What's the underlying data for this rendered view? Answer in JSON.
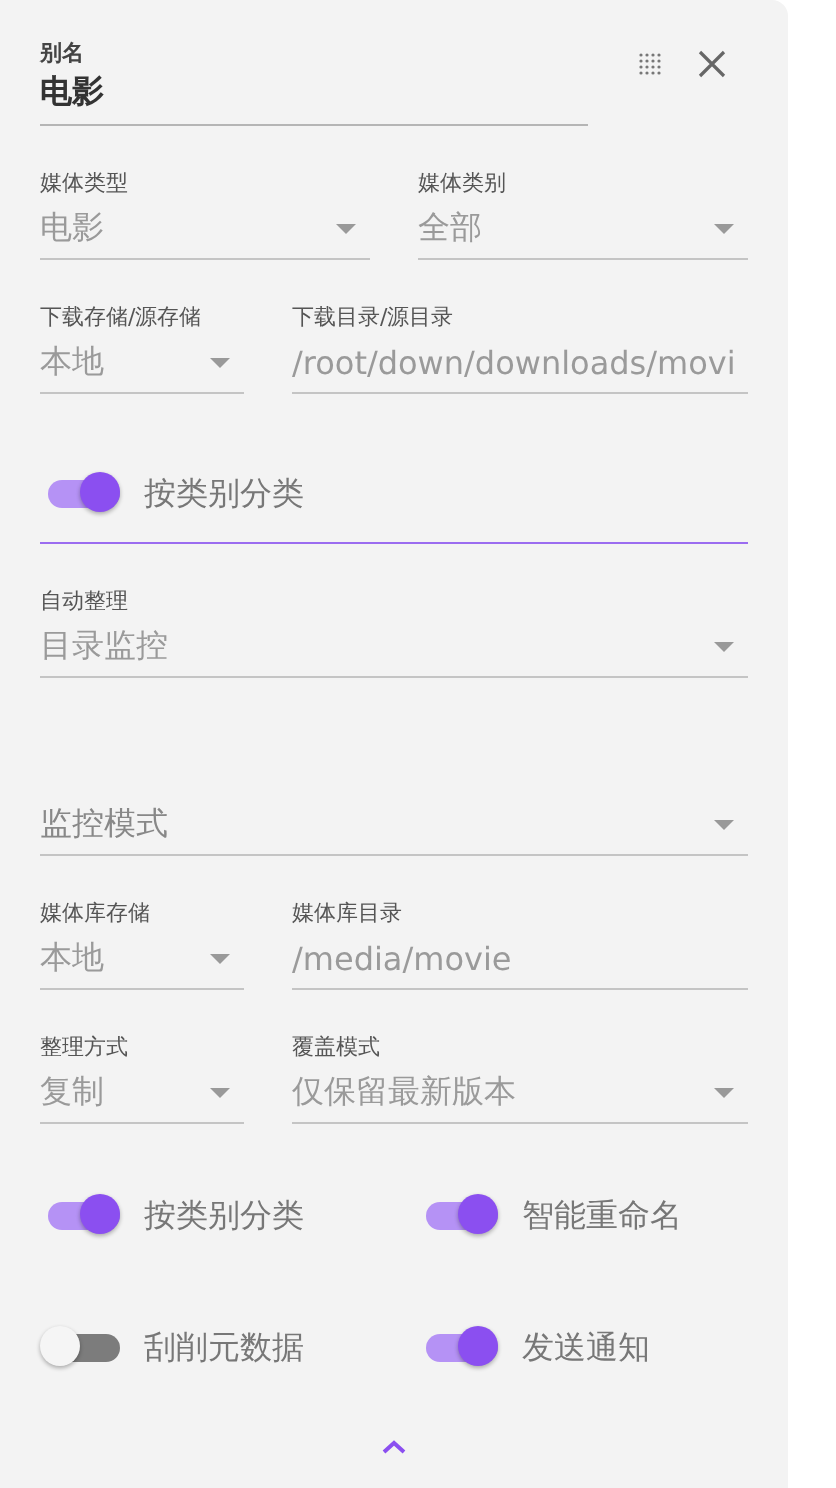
{
  "alias": {
    "label": "别名",
    "value": "电影"
  },
  "rows": [
    {
      "kind": "half",
      "fields": [
        {
          "kind": "select",
          "label": "媒体类型",
          "value": "电影"
        },
        {
          "kind": "select",
          "label": "媒体类别",
          "value": "全部"
        }
      ]
    },
    {
      "kind": "split",
      "fields": [
        {
          "kind": "select",
          "label": "下载存储/源存储",
          "value": "本地"
        },
        {
          "kind": "text",
          "label": "下载目录/源目录",
          "value": "/root/down/downloads/movi"
        }
      ]
    },
    {
      "kind": "toggle",
      "label": "按类别分类",
      "on": true,
      "focused": true
    },
    {
      "kind": "full",
      "fields": [
        {
          "kind": "select",
          "label": "自动整理",
          "value": "目录监控"
        }
      ]
    },
    {
      "kind": "full",
      "fields": [
        {
          "kind": "select",
          "placeholder": "监控模式"
        }
      ]
    },
    {
      "kind": "split",
      "fields": [
        {
          "kind": "select",
          "label": "媒体库存储",
          "value": "本地"
        },
        {
          "kind": "text",
          "label": "媒体库目录",
          "value": "/media/movie"
        }
      ]
    },
    {
      "kind": "split",
      "fields": [
        {
          "kind": "select",
          "label": "整理方式",
          "value": "复制"
        },
        {
          "kind": "select",
          "label": "覆盖模式",
          "value": "仅保留最新版本"
        }
      ]
    }
  ],
  "switches": [
    {
      "label": "按类别分类",
      "on": true
    },
    {
      "label": "智能重命名",
      "on": true
    },
    {
      "label": "刮削元数据",
      "on": false
    },
    {
      "label": "发送通知",
      "on": true
    }
  ]
}
